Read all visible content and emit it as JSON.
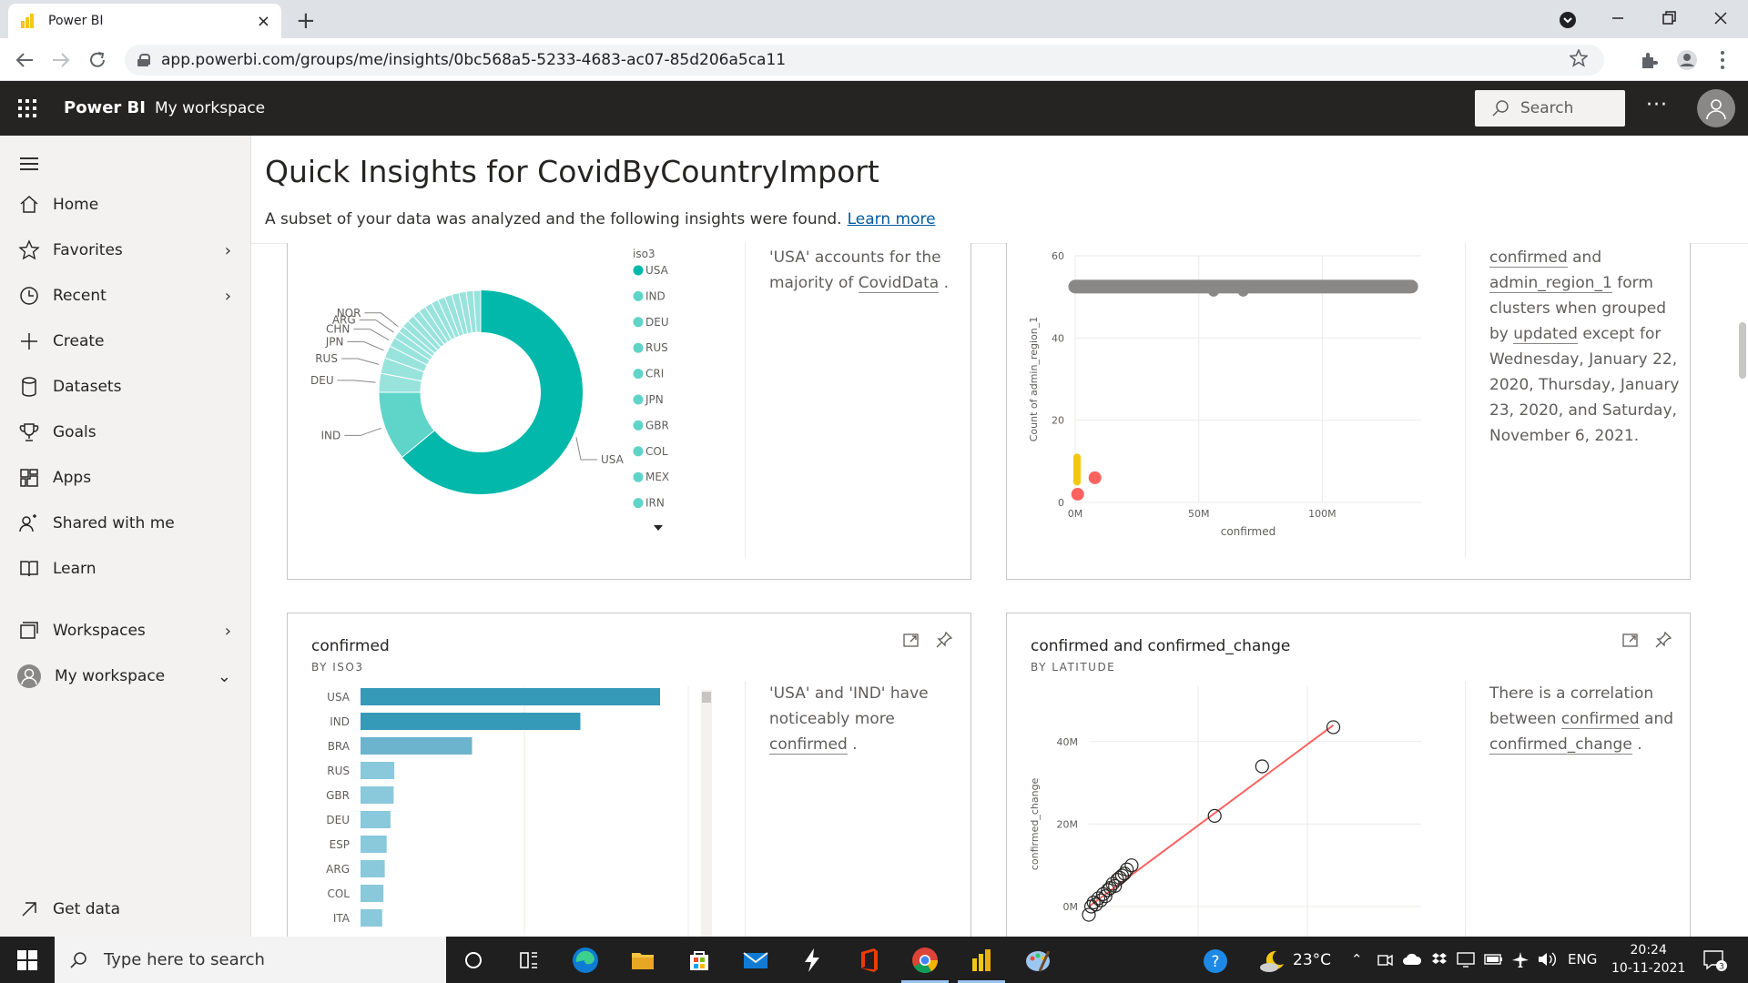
{
  "browser": {
    "tab_title": "Power BI",
    "tab_close": "×",
    "new_tab": "+",
    "url": "app.powerbi.com/groups/me/insights/0bc568a5-5233-4683-ac07-85d206a5ca11"
  },
  "header": {
    "brand": "Power BI",
    "workspace": "My workspace",
    "search_placeholder": "Search",
    "more": "···"
  },
  "nav": {
    "items": [
      {
        "label": "Home"
      },
      {
        "label": "Favorites"
      },
      {
        "label": "Recent"
      },
      {
        "label": "Create"
      },
      {
        "label": "Datasets"
      },
      {
        "label": "Goals"
      },
      {
        "label": "Apps"
      },
      {
        "label": "Shared with me"
      },
      {
        "label": "Learn"
      },
      {
        "label": "Workspaces"
      },
      {
        "label": "My workspace"
      },
      {
        "label": "Get data"
      }
    ]
  },
  "page": {
    "title": "Quick Insights for CovidByCountryImport",
    "subtitle": "A subset of your data was analyzed and the following insights were found.",
    "learn_more": "Learn more"
  },
  "cards": {
    "donut": {
      "insight_pre": "'USA' accounts for the majority of ",
      "insight_link": "CovidData",
      "insight_post": " ."
    },
    "scatter": {
      "insight_link1": "confirmed",
      "insight_and": " and ",
      "insight_link2": "admin_region_1",
      "insight_mid": " form clusters when grouped by ",
      "insight_link3": "updated",
      "insight_post": " except for Wednesday, January 22, 2020, Thursday, January 23, 2020, and Saturday, November 6, 2021."
    },
    "bar": {
      "title": "confirmed",
      "subtitle": "BY ISO3",
      "insight_pre": "'USA' and 'IND' have noticeably more ",
      "insight_link": "confirmed",
      "insight_post": " ."
    },
    "line": {
      "title": "confirmed and confirmed_change",
      "subtitle": "BY LATITUDE",
      "insight_pre": "There is a correlation between ",
      "insight_link1": "confirmed",
      "insight_and": " and ",
      "insight_link2": "confirmed_change",
      "insight_post": " ."
    }
  },
  "chart_data": [
    {
      "type": "pie",
      "variant": "donut",
      "legend_title": "iso3",
      "legend_items": [
        "USA",
        "IND",
        "DEU",
        "RUS",
        "CRI",
        "JPN",
        "GBR",
        "COL",
        "MEX",
        "IRN"
      ],
      "slice_labels": [
        "USA",
        "IND",
        "DEU",
        "RUS",
        "JPN",
        "CHN",
        "ARG",
        "NOR"
      ],
      "slices": [
        {
          "label": "USA",
          "value": 64
        },
        {
          "label": "IND",
          "value": 11
        },
        {
          "label": "DEU",
          "value": 3
        },
        {
          "label": "RUS",
          "value": 2.5
        },
        {
          "label": "JPN",
          "value": 2
        },
        {
          "label": "CHN",
          "value": 1.5
        },
        {
          "label": "ARG",
          "value": 1.2
        },
        {
          "label": "NOR",
          "value": 1
        }
      ],
      "other_slices_count": 12,
      "other_slice_value": 1.15,
      "colors": {
        "primary": "#01b8aa",
        "light": "#5fd4c8",
        "lighter": "#99e3dd"
      }
    },
    {
      "type": "scatter",
      "xlabel": "confirmed",
      "ylabel": "Count of admin_region_1",
      "xticks": [
        "0M",
        "50M",
        "100M"
      ],
      "yticks": [
        "0",
        "20",
        "40",
        "60"
      ],
      "xlim": [
        0,
        140
      ],
      "ylim": [
        0,
        60
      ],
      "x_unit": "M",
      "clusters": [
        {
          "color": "#8a8886",
          "x_range": [
            0,
            136
          ],
          "y": 52.5
        },
        {
          "color": "#f2c80f",
          "x_range": [
            0,
            1.5
          ],
          "y_range": [
            5,
            11
          ]
        },
        {
          "color": "#fd625e",
          "points": [
            [
              8,
              6
            ],
            [
              1,
              2
            ]
          ]
        }
      ]
    },
    {
      "type": "bar",
      "orientation": "horizontal",
      "categories": [
        "USA",
        "IND",
        "BRA",
        "RUS",
        "GBR",
        "DEU",
        "ESP",
        "ARG",
        "COL",
        "ITA"
      ],
      "values": [
        47,
        34.5,
        17.5,
        5.3,
        5.2,
        4.7,
        4.1,
        3.8,
        3.6,
        3.4
      ],
      "xlim": [
        0,
        60
      ],
      "colors": {
        "highlight": "#3599b8",
        "normal": "#8ac8dc",
        "mid": "#6cb3cd"
      }
    },
    {
      "type": "scatter",
      "xlabel": "",
      "ylabel": "confirmed_change",
      "yticks": [
        "0M",
        "20M",
        "40M"
      ],
      "ylim": [
        -2,
        46
      ],
      "xlim": [
        0,
        140
      ],
      "points": [
        [
          53,
          22
        ],
        [
          73,
          34
        ],
        [
          103,
          43.5
        ],
        [
          18,
          10
        ],
        [
          16,
          9
        ],
        [
          14,
          7.5
        ],
        [
          12,
          6.5
        ],
        [
          10,
          5.5
        ],
        [
          8,
          4
        ],
        [
          6,
          3
        ],
        [
          4,
          2
        ],
        [
          2,
          1
        ],
        [
          1,
          0
        ],
        [
          0,
          -2
        ],
        [
          3,
          0.5
        ],
        [
          5,
          1.5
        ],
        [
          7,
          2.5
        ],
        [
          9,
          4.5
        ],
        [
          11,
          5
        ],
        [
          13,
          7
        ],
        [
          15,
          8
        ]
      ],
      "trend": {
        "from": [
          0,
          0
        ],
        "to": [
          103,
          44
        ],
        "color": "#fd625e"
      }
    }
  ]
}
